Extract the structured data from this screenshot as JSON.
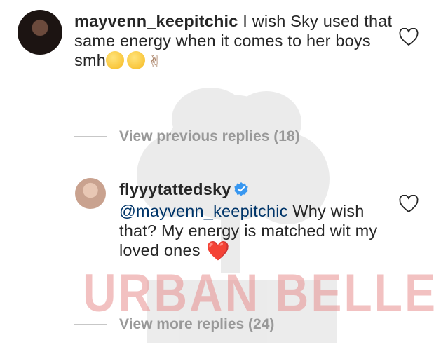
{
  "watermark": {
    "text": "URBAN BELLE",
    "color": "#e89090"
  },
  "comment": {
    "username": "mayvenn_keepitchic",
    "text": "I wish Sky used that same energy when it comes to her boys smh",
    "emojis": [
      "expressionless-face",
      "unamused-face",
      "victory-hand"
    ],
    "liked": false
  },
  "view_previous": {
    "label": "View previous replies (18)"
  },
  "reply": {
    "username": "flyyytattedsky",
    "verified": true,
    "mention": "@mayvenn_keepitchic",
    "text": "Why wish that? My energy is matched wit my loved ones",
    "emoji": "❤️",
    "liked": false
  },
  "view_more": {
    "label": "View more replies (24)"
  },
  "colors": {
    "text": "#262626",
    "mention": "#003569",
    "muted": "#999999",
    "verified": "#3897f0",
    "heart": "#e0242b"
  }
}
